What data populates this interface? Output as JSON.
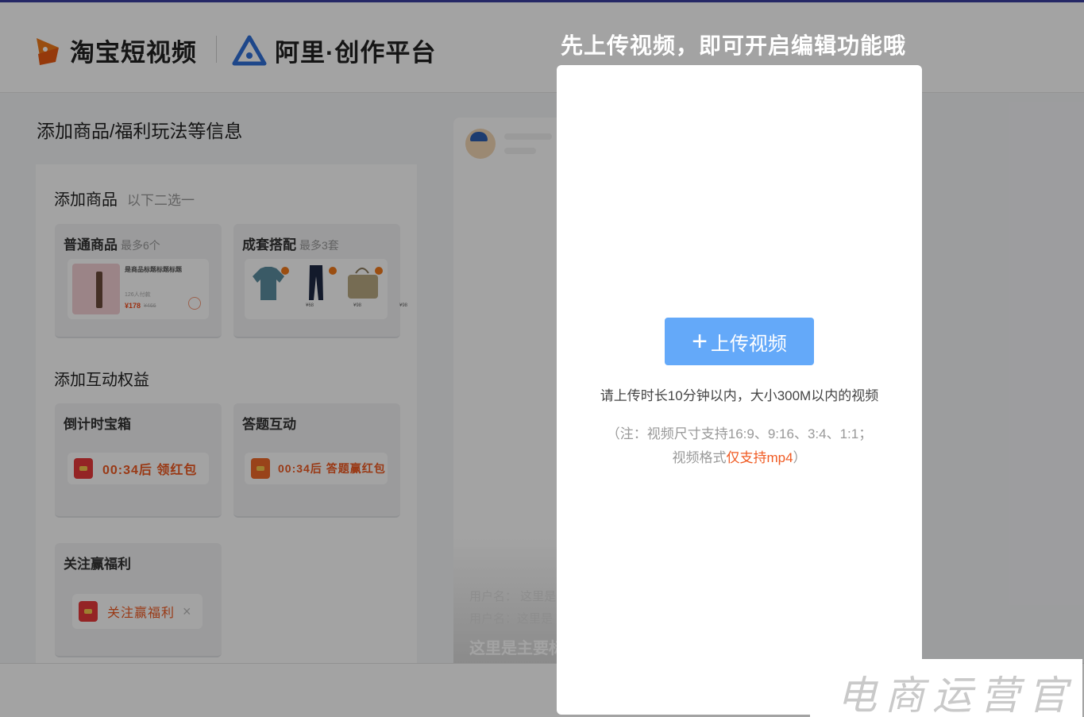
{
  "brand": {
    "logo1": "淘宝短视频",
    "logo2": "阿里·创作平台"
  },
  "page": {
    "section_title": "添加商品/福利玩法等信息"
  },
  "add_product": {
    "title": "添加商品",
    "hint": "以下二选一",
    "normal": {
      "title": "普通商品",
      "hint": "最多6个",
      "product_name": "是商品标题标题标题",
      "sales": "126人付款",
      "price": "¥178",
      "old_price": "¥466"
    },
    "set": {
      "title": "成套搭配",
      "hint": "最多3套",
      "prices": [
        "¥68",
        "¥98",
        "¥98"
      ]
    }
  },
  "interaction": {
    "title": "添加互动权益",
    "countdown": {
      "title": "倒计时宝箱",
      "chip": "00:34后  领红包"
    },
    "quiz": {
      "title": "答题互动",
      "chip": "00:34后  答题赢红包"
    },
    "follow": {
      "title": "关注赢福利",
      "chip": "关注赢福利",
      "close": "×"
    }
  },
  "preview": {
    "line1": "用户名：  这里是",
    "line2": "用户名：这里是",
    "main": "这里是主要标"
  },
  "modal": {
    "caption": "先上传视频，即可开启编辑功能哦",
    "upload_button": "上传视频",
    "plus": "+",
    "desc": "请上传时长10分钟以内，大小300M以内的视频",
    "note_line1": "（注：视频尺寸支持16:9、9:16、3:4、1:1；",
    "note_line2_prefix": "视频格式",
    "note_line2_highlight": "仅支持mp4",
    "note_line2_suffix": "）"
  },
  "watermark": "电商运营官",
  "colors": {
    "accent_blue": "#64a9f9",
    "highlight_orange": "#f05a22",
    "top_line": "#3b3fa0"
  }
}
